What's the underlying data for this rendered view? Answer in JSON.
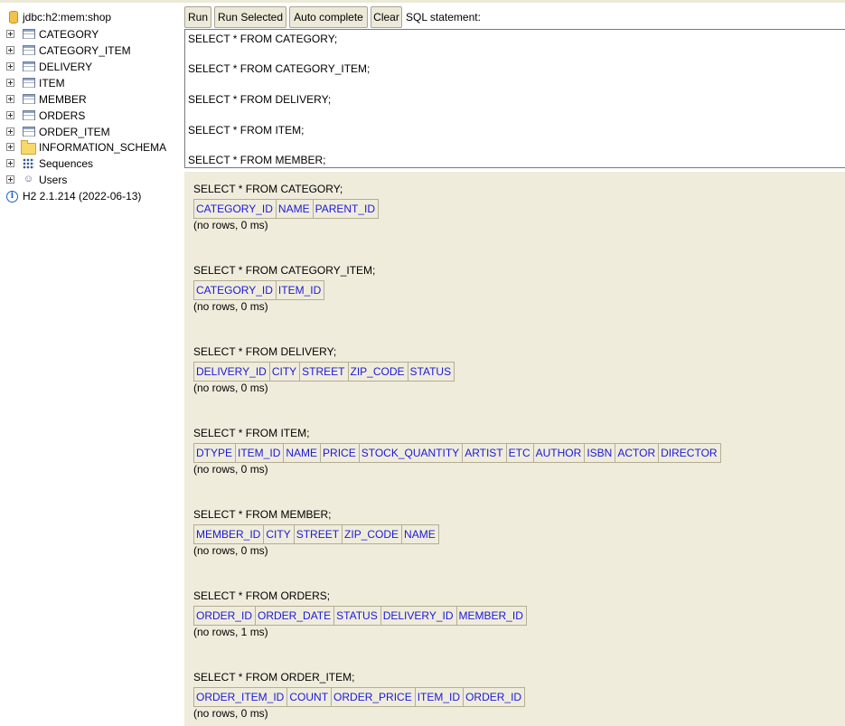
{
  "tree": {
    "connection": "jdbc:h2:mem:shop",
    "tables": [
      "CATEGORY",
      "CATEGORY_ITEM",
      "DELIVERY",
      "ITEM",
      "MEMBER",
      "ORDERS",
      "ORDER_ITEM"
    ],
    "schema": "INFORMATION_SCHEMA",
    "sequences": "Sequences",
    "users": "Users",
    "version": "H2 2.1.214 (2022-06-13)"
  },
  "toolbar": {
    "run": "Run",
    "run_selected": "Run Selected",
    "auto_complete": "Auto complete",
    "clear": "Clear",
    "sql_label": "SQL statement:"
  },
  "editor": {
    "lines": [
      "SELECT * FROM CATEGORY;",
      "SELECT * FROM CATEGORY_ITEM;",
      "SELECT * FROM DELIVERY;",
      "SELECT * FROM ITEM;",
      "SELECT * FROM MEMBER;"
    ]
  },
  "results": [
    {
      "statement": "SELECT * FROM CATEGORY;",
      "columns": [
        "CATEGORY_ID",
        "NAME",
        "PARENT_ID"
      ],
      "footer": "(no rows, 0 ms)"
    },
    {
      "statement": "SELECT * FROM CATEGORY_ITEM;",
      "columns": [
        "CATEGORY_ID",
        "ITEM_ID"
      ],
      "footer": "(no rows, 0 ms)"
    },
    {
      "statement": "SELECT * FROM DELIVERY;",
      "columns": [
        "DELIVERY_ID",
        "CITY",
        "STREET",
        "ZIP_CODE",
        "STATUS"
      ],
      "footer": "(no rows, 0 ms)"
    },
    {
      "statement": "SELECT * FROM ITEM;",
      "columns": [
        "DTYPE",
        "ITEM_ID",
        "NAME",
        "PRICE",
        "STOCK_QUANTITY",
        "ARTIST",
        "ETC",
        "AUTHOR",
        "ISBN",
        "ACTOR",
        "DIRECTOR"
      ],
      "footer": "(no rows, 0 ms)"
    },
    {
      "statement": "SELECT * FROM MEMBER;",
      "columns": [
        "MEMBER_ID",
        "CITY",
        "STREET",
        "ZIP_CODE",
        "NAME"
      ],
      "footer": "(no rows, 0 ms)"
    },
    {
      "statement": "SELECT * FROM ORDERS;",
      "columns": [
        "ORDER_ID",
        "ORDER_DATE",
        "STATUS",
        "DELIVERY_ID",
        "MEMBER_ID"
      ],
      "footer": "(no rows, 1 ms)"
    },
    {
      "statement": "SELECT * FROM ORDER_ITEM;",
      "columns": [
        "ORDER_ITEM_ID",
        "COUNT",
        "ORDER_PRICE",
        "ITEM_ID",
        "ORDER_ID"
      ],
      "footer": "(no rows, 0 ms)"
    }
  ],
  "icons": {
    "connection": "database-icon",
    "table": "table-icon",
    "schema": "folder-icon",
    "sequences": "sequence-icon",
    "users": "users-icon",
    "version": "info-icon",
    "expand": "plus-toggle-icon"
  }
}
